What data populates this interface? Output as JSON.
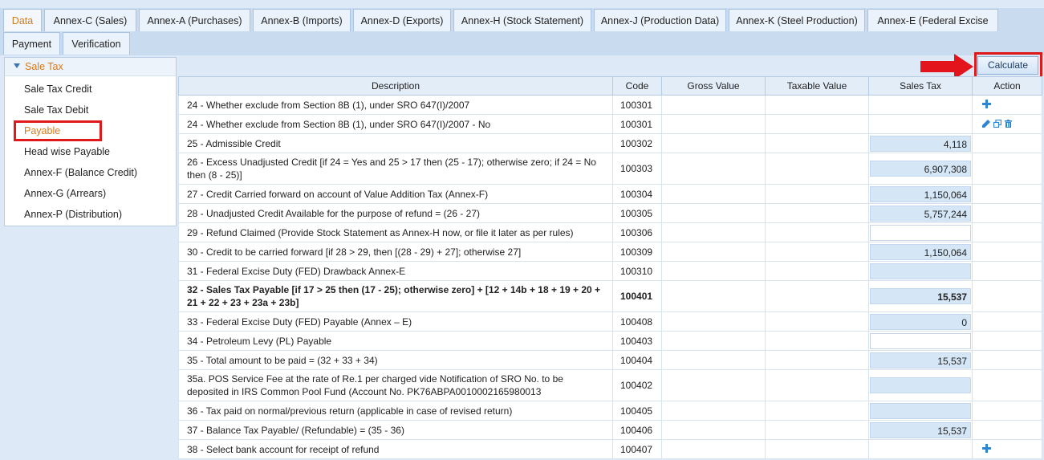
{
  "tabs": [
    {
      "label": "Data"
    },
    {
      "label": "Annex-C (Sales)"
    },
    {
      "label": "Annex-A (Purchases)"
    },
    {
      "label": "Annex-B (Imports)"
    },
    {
      "label": "Annex-D (Exports)"
    },
    {
      "label": "Annex-H (Stock Statement)"
    },
    {
      "label": "Annex-J (Production Data)"
    },
    {
      "label": "Annex-K (Steel Production)"
    },
    {
      "label": "Annex-E (Federal Excise"
    },
    {
      "label": "Payment"
    },
    {
      "label": "Verification"
    }
  ],
  "sidebar": {
    "section_label": "Sale Tax",
    "items": [
      {
        "label": "Sale Tax Credit"
      },
      {
        "label": "Sale Tax Debit"
      },
      {
        "label": "Payable"
      },
      {
        "label": "Head wise Payable"
      },
      {
        "label": "Annex-F (Balance Credit)"
      },
      {
        "label": "Annex-G (Arrears)"
      },
      {
        "label": "Annex-P (Distribution)"
      }
    ]
  },
  "toolbar": {
    "calculate_label": "Calculate"
  },
  "table": {
    "headers": {
      "description": "Description",
      "code": "Code",
      "gross": "Gross Value",
      "taxable": "Taxable Value",
      "sales_tax": "Sales Tax",
      "action": "Action"
    },
    "rows": [
      {
        "description": "24 - Whether exclude from Section 8B (1), under SRO 647(I)/2007",
        "code": "100301",
        "sales_tax": null,
        "action": "add"
      },
      {
        "description": "24 - Whether exclude from Section 8B (1), under SRO 647(I)/2007 - No",
        "code": "100301",
        "sales_tax": null,
        "action": "edit"
      },
      {
        "description": "25 - Admissible Credit",
        "code": "100302",
        "sales_tax": "4,118"
      },
      {
        "description": "26 - Excess Unadjusted Credit [if 24 = Yes and 25 > 17 then (25 - 17); otherwise zero; if 24 = No then (8 - 25)]",
        "code": "100303",
        "sales_tax": "6,907,308"
      },
      {
        "description": "27 - Credit Carried forward on account of Value Addition Tax (Annex-F)",
        "code": "100304",
        "sales_tax": "1,150,064"
      },
      {
        "description": "28 - Unadjusted Credit Available for the purpose of refund = (26 - 27)",
        "code": "100305",
        "sales_tax": "5,757,244"
      },
      {
        "description": "29 - Refund Claimed (Provide Stock Statement as Annex-H now, or file it later as per rules)",
        "code": "100306",
        "sales_tax": "",
        "input": "white"
      },
      {
        "description": "30 - Credit to be carried forward [if 28 > 29, then [(28 - 29) + 27]; otherwise 27]",
        "code": "100309",
        "sales_tax": "1,150,064"
      },
      {
        "description": "31 - Federal Excise Duty (FED) Drawback Annex-E",
        "code": "100310",
        "sales_tax": ""
      },
      {
        "description": "32 - Sales Tax Payable [if 17 > 25 then (17 - 25); otherwise zero] + [12 + 14b + 18 + 19 + 20 + 21 + 22 + 23 + 23a + 23b]",
        "code": "100401",
        "sales_tax": "15,537",
        "bold": true
      },
      {
        "description": "33 - Federal Excise Duty (FED) Payable (Annex – E)",
        "code": "100408",
        "sales_tax": "0"
      },
      {
        "description": "34 - Petroleum Levy (PL) Payable",
        "code": "100403",
        "sales_tax": "",
        "input": "white"
      },
      {
        "description": "35 - Total amount to be paid = (32 + 33 + 34)",
        "code": "100404",
        "sales_tax": "15,537"
      },
      {
        "description": "35a. POS Service Fee at the rate of Re.1 per charged vide Notification of SRO No. to be deposited in IRS Common Pool Fund (Account No. PK76ABPA0010002165980013",
        "code": "100402",
        "sales_tax": ""
      },
      {
        "description": "36 - Tax paid on normal/previous return (applicable in case of revised return)",
        "code": "100405",
        "sales_tax": ""
      },
      {
        "description": "37 - Balance Tax Payable/ (Refundable) = (35 - 36)",
        "code": "100406",
        "sales_tax": "15,537"
      },
      {
        "description": "38 - Select bank account for receipt of refund",
        "code": "100407",
        "sales_tax": null,
        "action": "add"
      }
    ]
  }
}
